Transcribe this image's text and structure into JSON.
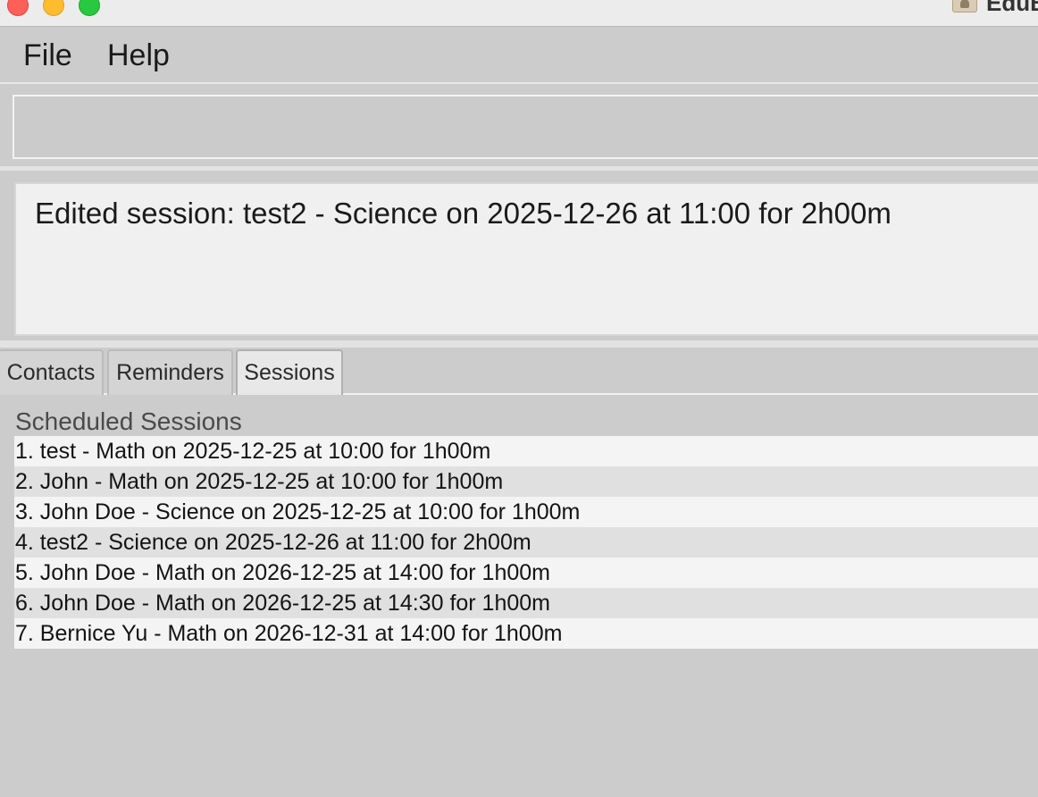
{
  "window": {
    "title": "EduB"
  },
  "menu": {
    "file": "File",
    "help": "Help"
  },
  "command": {
    "value": ""
  },
  "result": {
    "message": "Edited session: test2 - Science on 2025-12-26 at 11:00 for 2h00m"
  },
  "tabs": [
    {
      "label": "Contacts",
      "selected": false
    },
    {
      "label": "Reminders",
      "selected": false
    },
    {
      "label": "Sessions",
      "selected": true
    }
  ],
  "sessions": {
    "title": "Scheduled Sessions",
    "items": [
      "1. test - Math on 2025-12-25 at 10:00 for 1h00m",
      "2. John - Math on 2025-12-25 at 10:00 for 1h00m",
      "3. John Doe - Science on 2025-12-25 at 10:00 for 1h00m",
      "4. test2 - Science on 2025-12-26 at 11:00 for 2h00m",
      "5. John Doe - Math on 2026-12-25 at 14:00 for 1h00m",
      "6. John Doe - Math on 2026-12-25 at 14:30 for 1h00m",
      "7. Bernice Yu - Math on 2026-12-31 at 14:00 for 1h00m"
    ]
  }
}
